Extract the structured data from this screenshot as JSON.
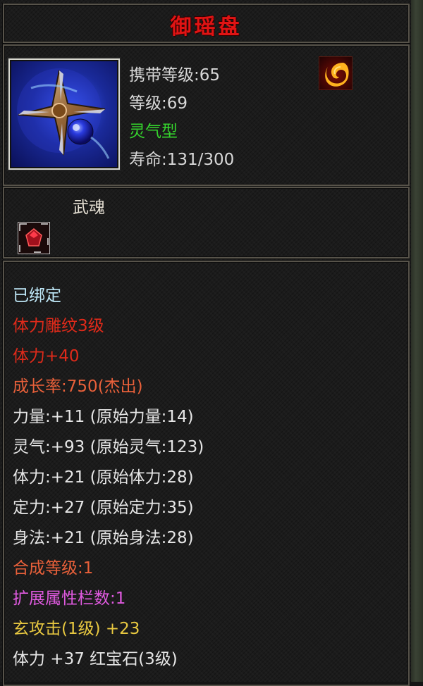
{
  "title": "御瑶盘",
  "header": {
    "carry_level": "携带等级:65",
    "level": "等级:69",
    "type": "灵气型",
    "lifespan": "寿命:131/300"
  },
  "icons": {
    "item_icon": "shuriken-item-icon",
    "element_icon": "flame-swirl-icon",
    "soul_gem_icon": "red-gem-icon"
  },
  "soul": {
    "label": "武魂"
  },
  "details": {
    "lines": [
      "已绑定",
      "体力雕纹3级",
      "体力+40",
      "成长率:750(杰出)",
      "力量:+11 (原始力量:14)",
      "灵气:+93 (原始灵气:123)",
      "体力:+21 (原始体力:28)",
      "定力:+27 (原始定力:35)",
      "身法:+21 (原始身法:28)",
      "合成等级:1",
      "扩展属性栏数:1",
      "玄攻击(1级) +23",
      "体力 +37 红宝石(3级)"
    ]
  },
  "colors": {
    "title": "#e01414",
    "bound": "#bfe8f8",
    "engrave": "#e02a1a",
    "growth": "#e8603a",
    "stats": "#e6e6e6",
    "synth": "#e8603a",
    "expand": "#e05ae0",
    "special": "#e8c840",
    "type": "#35d62d"
  }
}
